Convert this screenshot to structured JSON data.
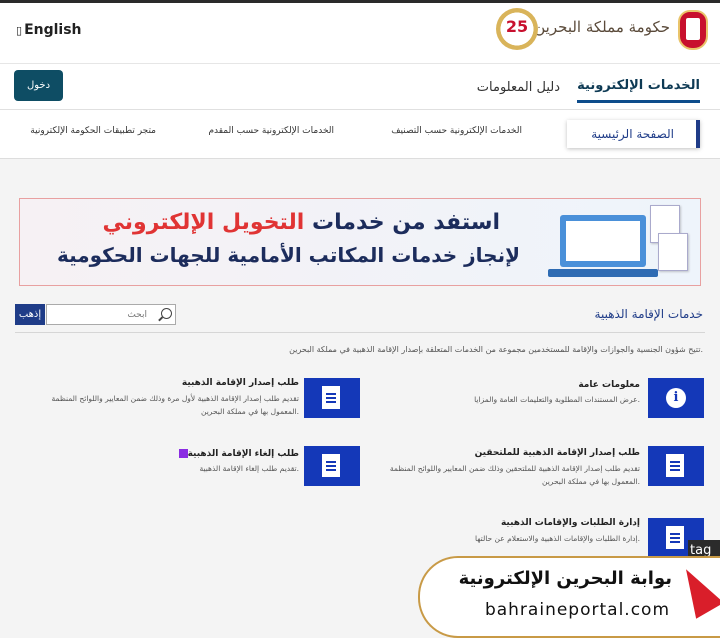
{
  "header": {
    "language_label": "English",
    "gov_title": "حكومة مملكة البحرين",
    "anniversary_badge": "25"
  },
  "nav": {
    "login_label": "دخول",
    "tabs": [
      {
        "label": "الخدمات الإلكترونية",
        "active": true
      },
      {
        "label": "دليل المعلومات",
        "active": false
      }
    ]
  },
  "subnav": {
    "items": [
      {
        "label": "الصفحة الرئيسية",
        "active": true
      },
      {
        "label": "الخدمات الإلكترونية حسب التصنيف"
      },
      {
        "label": "الخدمات الإلكترونية حسب المقدم"
      },
      {
        "label": "متجر تطبيقات الحكومة الإلكترونية"
      }
    ]
  },
  "banner": {
    "line1_prefix": "استفد من خدمات ",
    "line1_highlight": "التخويل الإلكتروني",
    "line2": "لإنجاز خدمات المكاتب الأمامية للجهات الحكومية"
  },
  "search": {
    "go_label": "إذهب",
    "placeholder": "ابحث"
  },
  "section": {
    "title": "خدمات الإقامة الذهبية",
    "description": "تتيح شؤون الجنسية والجوازات والإقامة للمستخدمين مجموعة من الخدمات المتعلقة بإصدار الإقامة الذهبية في مملكة البحرين."
  },
  "services": [
    {
      "title": "معلومات عامة",
      "desc": "عرض المستندات المطلوبة والتعليمات العامة والمزايا.",
      "icon": "info-icon"
    },
    {
      "title": "طلب إصدار الإقامة الذهبية",
      "desc": "تقديم طلب إصدار الإقامة الذهبية لأول مرة وذلك ضمن المعايير واللوائح المنظمة المعمول بها في مملكة البحرين.",
      "icon": "document-icon"
    },
    {
      "title": "طلب إصدار الإقامة الذهبية للملتحقين",
      "desc": "تقديم طلب إصدار الإقامة الذهبية للملتحقين وذلك ضمن المعايير واللوائح المنظمة المعمول بها في مملكة البحرين.",
      "icon": "document-icon"
    },
    {
      "title": "طلب إلغاء الإقامة الذهبية",
      "desc": "تقديم طلب إلغاء الإقامة الذهبية.",
      "icon": "document-icon"
    },
    {
      "title": "إدارة الطلبات والإقامات الذهبية",
      "desc": "إدارة الطلبات والإقامات الذهبية والاستعلام عن حالتها.",
      "icon": "document-icon"
    }
  ],
  "overlay": {
    "portal_ar": "بوابة البحرين الإلكترونية",
    "portal_en": "bahraineportal.com",
    "tag": "tag"
  },
  "colors": {
    "primary": "#1f3c88",
    "card_icon": "#1438b8",
    "login": "#0e4d64",
    "highlight_red": "#e03434"
  }
}
